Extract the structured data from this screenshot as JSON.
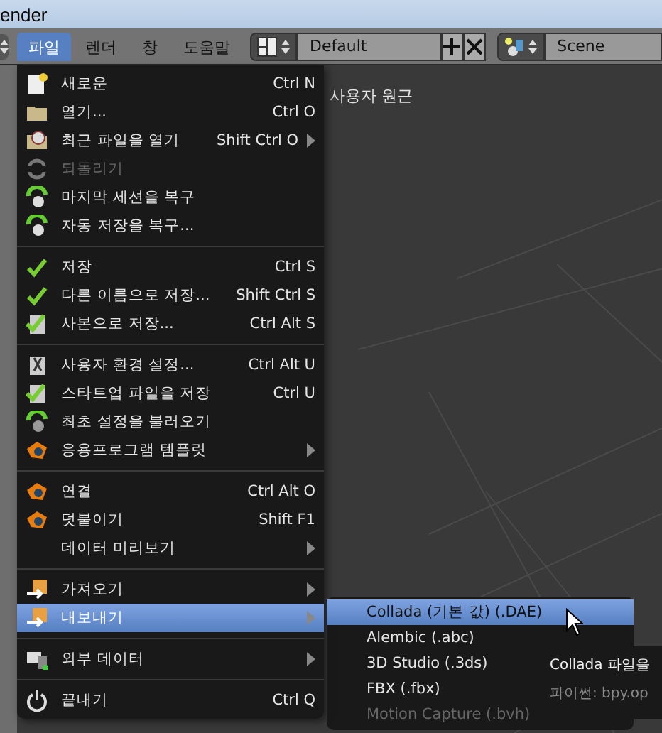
{
  "window": {
    "title": "ender"
  },
  "header": {
    "menus": [
      {
        "label": "파일",
        "selected": true
      },
      {
        "label": "렌더",
        "selected": false
      },
      {
        "label": "창",
        "selected": false
      },
      {
        "label": "도움말",
        "selected": false
      }
    ],
    "layout": "Default",
    "scene": "Scene"
  },
  "viewport": {
    "label": "사용자 원근"
  },
  "file_menu": [
    {
      "kind": "item",
      "label": "새로운",
      "shortcut": "Ctrl N",
      "submenu": false,
      "disabled": false,
      "selected": false
    },
    {
      "kind": "item",
      "label": "열기...",
      "shortcut": "Ctrl O",
      "submenu": false,
      "disabled": false,
      "selected": false
    },
    {
      "kind": "item",
      "label": "최근 파일을 열기",
      "shortcut": "Shift Ctrl O",
      "submenu": true,
      "disabled": false,
      "selected": false
    },
    {
      "kind": "item",
      "label": "되돌리기",
      "submenu": false,
      "disabled": true,
      "selected": false
    },
    {
      "kind": "item",
      "label": "마지막 세션을 복구",
      "submenu": false,
      "disabled": false,
      "selected": false
    },
    {
      "kind": "item",
      "label": "자동 저장을 복구...",
      "submenu": false,
      "disabled": false,
      "selected": false
    },
    {
      "kind": "separator"
    },
    {
      "kind": "item",
      "label": "저장",
      "shortcut": "Ctrl S",
      "submenu": false,
      "disabled": false,
      "selected": false
    },
    {
      "kind": "item",
      "label": "다른 이름으로 저장...",
      "shortcut": "Shift Ctrl S",
      "submenu": false,
      "disabled": false,
      "selected": false
    },
    {
      "kind": "item",
      "label": "사본으로 저장...",
      "shortcut": "Ctrl Alt S",
      "submenu": false,
      "disabled": false,
      "selected": false
    },
    {
      "kind": "separator"
    },
    {
      "kind": "item",
      "label": "사용자 환경 설정...",
      "shortcut": "Ctrl Alt U",
      "submenu": false,
      "disabled": false,
      "selected": false
    },
    {
      "kind": "item",
      "label": "스타트업 파일을 저장",
      "shortcut": "Ctrl U",
      "submenu": false,
      "disabled": false,
      "selected": false
    },
    {
      "kind": "item",
      "label": "최초 설정을 불러오기",
      "submenu": false,
      "disabled": false,
      "selected": false
    },
    {
      "kind": "item",
      "label": "응용프로그램 템플릿",
      "submenu": true,
      "disabled": false,
      "selected": false
    },
    {
      "kind": "separator"
    },
    {
      "kind": "item",
      "label": "연결",
      "shortcut": "Ctrl Alt O",
      "submenu": false,
      "disabled": false,
      "selected": false
    },
    {
      "kind": "item",
      "label": "덧붙이기",
      "shortcut": "Shift F1",
      "submenu": false,
      "disabled": false,
      "selected": false
    },
    {
      "kind": "item",
      "label": "데이터 미리보기",
      "submenu": true,
      "disabled": false,
      "selected": false
    },
    {
      "kind": "separator"
    },
    {
      "kind": "item",
      "label": "가져오기",
      "submenu": true,
      "disabled": false,
      "selected": false
    },
    {
      "kind": "item",
      "label": "내보내기",
      "submenu": true,
      "disabled": false,
      "selected": true
    },
    {
      "kind": "separator"
    },
    {
      "kind": "item",
      "label": "외부 데이터",
      "submenu": true,
      "disabled": false,
      "selected": false
    },
    {
      "kind": "separator"
    },
    {
      "kind": "item",
      "label": "끝내기",
      "shortcut": "Ctrl Q",
      "submenu": false,
      "disabled": false,
      "selected": false
    }
  ],
  "export_menu": [
    {
      "label": "Collada (기본 값) (.DAE)",
      "selected": true,
      "disabled": false
    },
    {
      "label": "Alembic (.abc)",
      "selected": false,
      "disabled": false
    },
    {
      "label": "3D Studio (.3ds)",
      "selected": false,
      "disabled": false
    },
    {
      "label": "FBX (.fbx)",
      "selected": false,
      "disabled": false
    },
    {
      "label": "Motion Capture (.bvh)",
      "selected": false,
      "disabled": true
    }
  ],
  "tooltip": {
    "text": "Collada 파일을",
    "python": "파이썬: bpy.op"
  }
}
